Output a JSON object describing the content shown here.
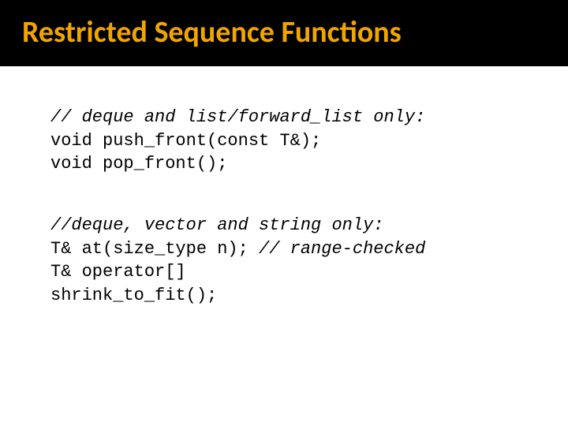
{
  "title": "Restricted Sequence Functions",
  "block1": {
    "comment": "// deque and list/forward_list only:",
    "line1": "void push_front(const T&);",
    "line2": "void pop_front();"
  },
  "block2": {
    "comment": "//deque, vector and string only:",
    "line1_a": "T& at(size_type n); ",
    "line1_b": "// range-checked",
    "line2": "T& operator[]",
    "line3": "shrink_to_fit();"
  }
}
